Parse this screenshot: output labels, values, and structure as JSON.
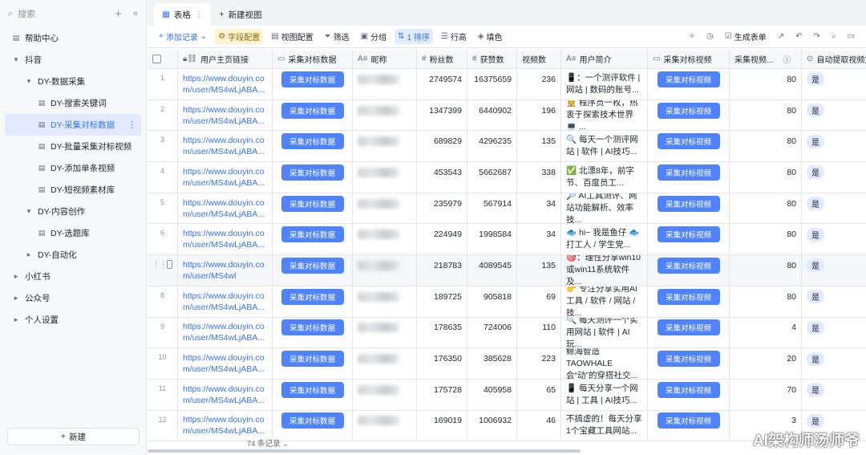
{
  "sidebar": {
    "search_placeholder": "搜索",
    "new_label": "新建",
    "items": [
      {
        "label": "帮助中心",
        "icon": "doc-icon",
        "level": 0
      },
      {
        "label": "抖音",
        "icon": "caret-down-icon",
        "level": 0
      },
      {
        "label": "DY-数据采集",
        "icon": "caret-down-icon",
        "level": 1
      },
      {
        "label": "DY-搜索关键词",
        "icon": "table-icon",
        "level": 2
      },
      {
        "label": "DY-采集对标数据",
        "icon": "table-icon",
        "level": 2,
        "active": true
      },
      {
        "label": "DY-批量采集对标视频",
        "icon": "table-icon",
        "level": 2
      },
      {
        "label": "DY-添加单条视频",
        "icon": "table-icon",
        "level": 2
      },
      {
        "label": "DY-短视频素材库",
        "icon": "table-icon",
        "level": 2
      },
      {
        "label": "DY-内容创作",
        "icon": "caret-down-icon",
        "level": 1
      },
      {
        "label": "DY-选题库",
        "icon": "table-icon",
        "level": 2
      },
      {
        "label": "DY-自动化",
        "icon": "caret-right-icon",
        "level": 1
      },
      {
        "label": "小红书",
        "icon": "caret-right-icon",
        "level": 0
      },
      {
        "label": "公众号",
        "icon": "caret-right-icon",
        "level": 0
      },
      {
        "label": "个人设置",
        "icon": "caret-right-icon",
        "level": 0
      }
    ]
  },
  "tabs": {
    "active": "表格",
    "new_view": "新建视图"
  },
  "toolbar": {
    "add_record": "添加记录",
    "field_config": "字段配置",
    "view_config": "视图配置",
    "filter": "筛选",
    "group": "分组",
    "sort": "1 排序",
    "row_height": "行高",
    "fill": "填色",
    "gen_form": "生成表单"
  },
  "columns": [
    "用户主页链接",
    "采集对标数据",
    "昵称",
    "粉丝数",
    "获赞数",
    "视频数",
    "用户简介",
    "采集对标视频",
    "采集视频...",
    "自动提取视频文"
  ],
  "button_label_data": "采集对标数据",
  "button_label_video": "采集对标视频",
  "rows": [
    {
      "n": "1",
      "link": "https://www.douyin.com/user/MS4wLjABA...",
      "fans": "2749574",
      "likes": "16375659",
      "videos": "236",
      "intro": "📱：一个测评软件 | 网站 | 数码的账号...",
      "cv": "80",
      "auto": "是"
    },
    {
      "n": "2",
      "link": "https://www.douyin.com/user/MS4wLjABA...",
      "fans": "1347399",
      "likes": "6440902",
      "videos": "196",
      "intro": "👷 程序员一枚，热衷于探索技术世界💻 ...",
      "cv": "80",
      "auto": "是"
    },
    {
      "n": "3",
      "link": "https://www.douyin.com/user/MS4wLjABA...",
      "fans": "689829",
      "likes": "4296235",
      "videos": "135",
      "intro": "🔍 每天一个测评网站 | 软件 | AI技巧...",
      "cv": "80",
      "auto": "是"
    },
    {
      "n": "4",
      "link": "https://www.douyin.com/user/MS4wLjABA...",
      "fans": "453543",
      "likes": "5662687",
      "videos": "338",
      "intro": "✅ 北漂8年，前字节、百度员工...",
      "cv": "80",
      "auto": "是"
    },
    {
      "n": "5",
      "link": "https://www.douyin.com/user/MS4wLjABA...",
      "fans": "235979",
      "likes": "567914",
      "videos": "34",
      "intro": "🔎 AI工具测评、网站功能解析、效率技...",
      "cv": "80",
      "auto": "是"
    },
    {
      "n": "6",
      "link": "https://www.douyin.com/user/MS4wLjABA...",
      "fans": "224949",
      "likes": "1998584",
      "videos": "34",
      "intro": "🐟 hi~ 我是鱼仔 🐟 打工人 / 学生党...",
      "cv": "80",
      "auto": "是"
    },
    {
      "n": "",
      "link": "https://www.douyin.com/user/MS4wl",
      "fans": "218783",
      "likes": "4089545",
      "videos": "135",
      "intro": "🎯：理性分享win10或win11系统软件及...",
      "cv": "80",
      "auto": "是"
    },
    {
      "n": "8",
      "link": "https://www.douyin.com/user/MS4wLjABA...",
      "fans": "189725",
      "likes": "905818",
      "videos": "69",
      "intro": "👉 专注分享实用AI工具 / 软件 / 网站 / 技...",
      "cv": "80",
      "auto": "是"
    },
    {
      "n": "9",
      "link": "https://www.douyin.com/user/MS4wLjABA...",
      "fans": "178635",
      "likes": "724006",
      "videos": "110",
      "intro": "🔍 每天测评一个实用网站 | 软件 | AI玩...",
      "cv": "4",
      "auto": "是"
    },
    {
      "n": "10",
      "link": "https://www.douyin.com/user/MS4wLjABA...",
      "fans": "176350",
      "likes": "385628",
      "videos": "223",
      "intro": "鲸海智造TAOWHALE 会“动”的穿搭社交...",
      "cv": "20",
      "auto": "是"
    },
    {
      "n": "11",
      "link": "https://www.douyin.com/user/MS4wLjABA...",
      "fans": "175728",
      "likes": "405958",
      "videos": "65",
      "intro": "📱 每天分享一个网站 | 工具 | AI技巧...",
      "cv": "70",
      "auto": "是"
    },
    {
      "n": "12",
      "link": "https://www.douyin.com/user/MS4wLjABA...",
      "fans": "169019",
      "likes": "1006932",
      "videos": "46",
      "intro": "不搞虚的！每天分享1个宝藏工具网站...",
      "cv": "3",
      "auto": "是"
    }
  ],
  "footer": {
    "count": "74 条记录"
  },
  "watermark": "AI架构师汤师爷"
}
